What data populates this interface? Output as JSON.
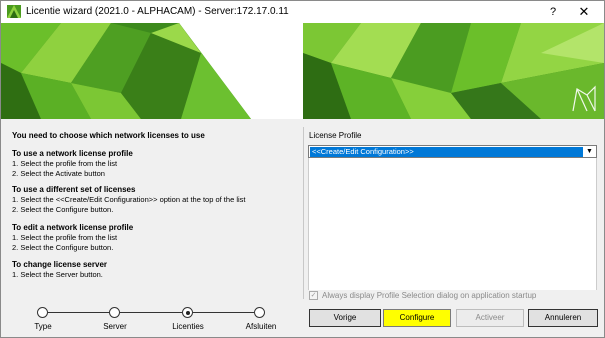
{
  "window": {
    "title": "Licentie wizard (2021.0 - ALPHACAM) - Server:172.17.0.11",
    "help_label": "?",
    "close_label": "✕"
  },
  "colors": {
    "accent": "#0078d7",
    "highlight": "#ffff00",
    "banner_green": "#5fb526"
  },
  "instructions": {
    "intro": "You need to choose which network licenses to use",
    "sections": [
      {
        "heading": "To use a network license profile",
        "lines": [
          "1. Select the profile from the list",
          "2. Select the Activate button"
        ]
      },
      {
        "heading": "To use a different set of licenses",
        "lines": [
          "1. Select the <<Create/Edit Configuration>> option at the top of the list",
          "2. Select the Configure button."
        ]
      },
      {
        "heading": "To edit a network license profile",
        "lines": [
          "1. Select the profile from the list",
          "2. Select the Configure button."
        ]
      },
      {
        "heading": "To change license server",
        "lines": [
          "1. Select the Server button."
        ]
      }
    ]
  },
  "steps": [
    {
      "label": "Type",
      "active": false
    },
    {
      "label": "Server",
      "active": false
    },
    {
      "label": "Licenties",
      "active": true
    },
    {
      "label": "Afsluiten",
      "active": false
    }
  ],
  "profile": {
    "label": "License Profile",
    "selected": "<<Create/Edit Configuration>>"
  },
  "checkbox": {
    "label": "Always display Profile Selection dialog on application startup",
    "checked": true
  },
  "buttons": {
    "back": "Vorige",
    "configure": "Configure",
    "activate": "Activeer",
    "cancel": "Annuleren"
  }
}
